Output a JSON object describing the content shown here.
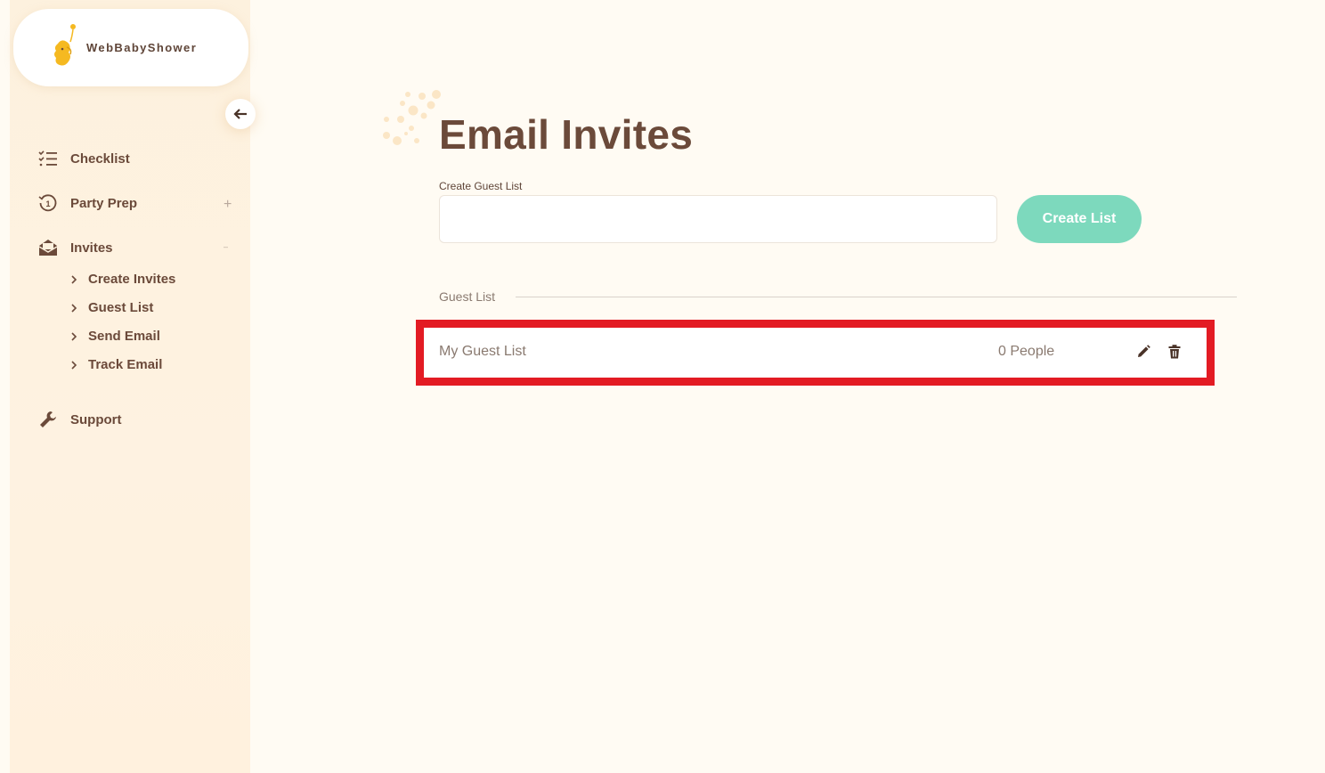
{
  "brand": {
    "name": "WebBabyShower"
  },
  "sidebar": {
    "items": [
      {
        "label": "Checklist",
        "icon": "checklist-icon"
      },
      {
        "label": "Party Prep",
        "icon": "clock-history-icon",
        "toggle": "+"
      },
      {
        "label": "Invites",
        "icon": "envelope-open-icon",
        "toggle": "–"
      },
      {
        "label": "Support",
        "icon": "wrench-icon"
      }
    ],
    "invites_sub": [
      {
        "label": "Create Invites"
      },
      {
        "label": "Guest List"
      },
      {
        "label": "Send Email"
      },
      {
        "label": "Track Email"
      }
    ]
  },
  "main": {
    "title": "Email Invites",
    "create_field": {
      "label": "Create Guest List",
      "value": "",
      "placeholder": ""
    },
    "create_button": "Create List",
    "section_label": "Guest List",
    "guest_lists": [
      {
        "name": "My Guest List",
        "count": "0 People"
      }
    ]
  },
  "colors": {
    "accent": "#7dd9bd",
    "text": "#6b4a3a",
    "highlight": "#e31b23",
    "brand_yellow": "#f5b921"
  }
}
